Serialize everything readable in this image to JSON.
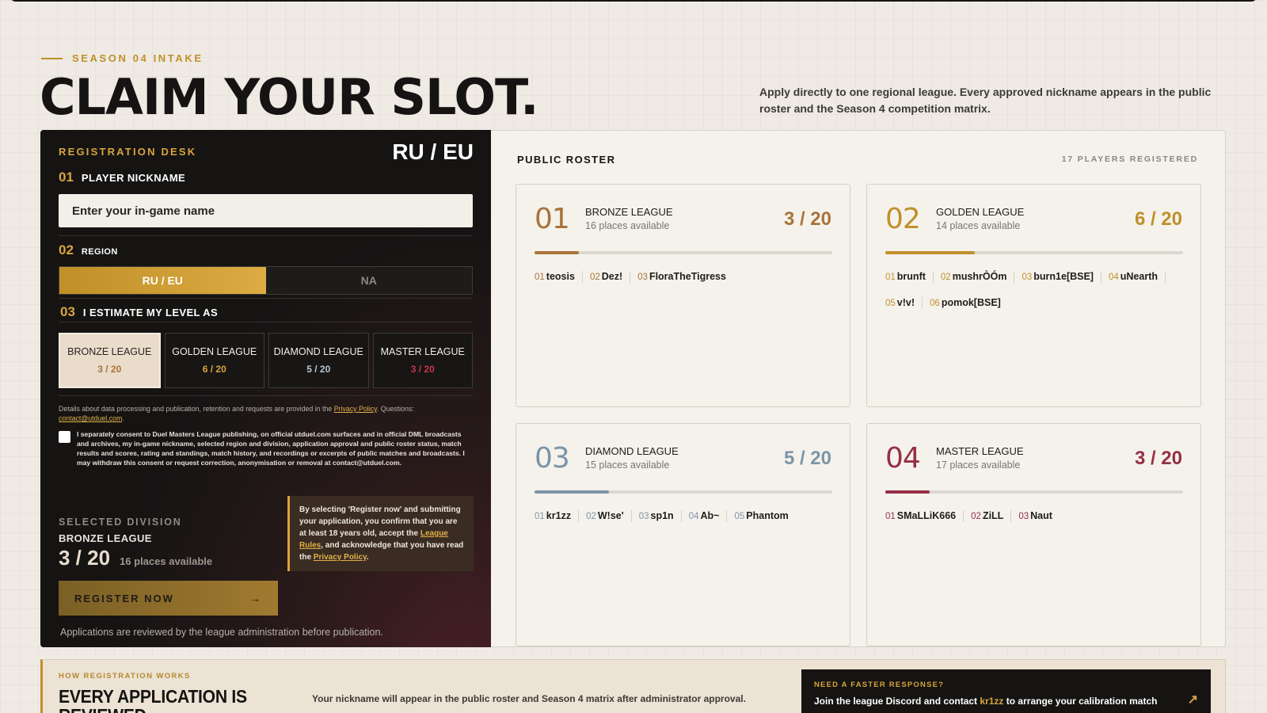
{
  "hero": {
    "eyebrow": "SEASON 04 INTAKE",
    "title": "CLAIM YOUR SLOT.",
    "intro": "Apply directly to one regional league. Every approved nickname appears in the public roster and the Season 4 competition matrix."
  },
  "registration": {
    "title": "REGISTRATION DESK",
    "region_display": "RU / EU",
    "step1": {
      "num": "01",
      "label": "PLAYER NICKNAME"
    },
    "nickname_placeholder": "Enter your in-game name",
    "step2": {
      "num": "02",
      "label": "REGION"
    },
    "regions": [
      {
        "label": "RU / EU",
        "active": true
      },
      {
        "label": "NA",
        "active": false
      }
    ],
    "step3": {
      "num": "03",
      "label": "I ESTIMATE MY LEVEL AS"
    },
    "levels": [
      {
        "name": "BRONZE LEAGUE",
        "count": "3 / 20",
        "color": "#a8733a",
        "selected": true
      },
      {
        "name": "GOLDEN LEAGUE",
        "count": "6 / 20",
        "color": "#d9a43d",
        "selected": false
      },
      {
        "name": "DIAMOND LEAGUE",
        "count": "5 / 20",
        "color": "#b8c6d2",
        "selected": false
      },
      {
        "name": "MASTER LEAGUE",
        "count": "3 / 20",
        "color": "#c8354c",
        "selected": false
      }
    ],
    "privacy_text": "Details about data processing and publication, retention and requests are provided in the",
    "privacy_link": "Privacy Policy",
    "questions_text": ". Questions:",
    "contact_email": "contact@utduel.com",
    "consent_text": "I separately consent to Duel Masters League publishing, on official utduel.com surfaces and in official DML broadcasts and archives, my in-game nickname, selected region and division, application approval and public roster status, match results and scores, rating and standings, match history, and recordings or excerpts of public matches and broadcasts. I may withdraw this consent or request correction, anonymisation or removal at contact@utduel.com.",
    "selected_label": "SELECTED DIVISION",
    "selected_name": "BRONZE LEAGUE",
    "selected_count": "3 / 20",
    "selected_available": "16 places available",
    "notice_part1": "By selecting 'Register now' and submitting your application, you confirm that you are at least 18 years old, accept the",
    "notice_link1": "League Rules",
    "notice_part2": ", and acknowledge that you have read the",
    "notice_link2": "Privacy Policy",
    "notice_end": ".",
    "register_label": "REGISTER NOW",
    "register_arrow": "→",
    "review_note": "Applications are reviewed by the league administration before publication."
  },
  "roster": {
    "title": "PUBLIC ROSTER",
    "count_label": "17 PLAYERS REGISTERED",
    "leagues": [
      {
        "num": "01",
        "name": "BRONZE LEAGUE",
        "available": "16 places available",
        "count": "3 / 20",
        "fill": 0.15,
        "color": "#a8733a",
        "players": [
          {
            "n": "01",
            "name": "teosis"
          },
          {
            "n": "02",
            "name": "Dez!"
          },
          {
            "n": "03",
            "name": "FloraTheTigress"
          }
        ]
      },
      {
        "num": "02",
        "name": "GOLDEN LEAGUE",
        "available": "14 places available",
        "count": "6 / 20",
        "fill": 0.3,
        "color": "#c0902b",
        "players": [
          {
            "n": "01",
            "name": "brunft"
          },
          {
            "n": "02",
            "name": "mushrÒÓm"
          },
          {
            "n": "03",
            "name": "burn1e[BSE]"
          },
          {
            "n": "04",
            "name": "uNearth"
          },
          {
            "n": "05",
            "name": "v!v!"
          },
          {
            "n": "06",
            "name": "pomok[BSE]"
          }
        ]
      },
      {
        "num": "03",
        "name": "DIAMOND LEAGUE",
        "available": "15 places available",
        "count": "5 / 20",
        "fill": 0.25,
        "color": "#7d94a6",
        "players": [
          {
            "n": "01",
            "name": "kr1zz"
          },
          {
            "n": "02",
            "name": "W!se'"
          },
          {
            "n": "03",
            "name": "sp1n"
          },
          {
            "n": "04",
            "name": "Ab~"
          },
          {
            "n": "05",
            "name": "Phantom"
          }
        ]
      },
      {
        "num": "04",
        "name": "MASTER LEAGUE",
        "available": "17 places available",
        "count": "3 / 20",
        "fill": 0.15,
        "color": "#962f45",
        "players": [
          {
            "n": "01",
            "name": "SMaLLiK666"
          },
          {
            "n": "02",
            "name": "ZiLL"
          },
          {
            "n": "03",
            "name": "Naut"
          }
        ]
      }
    ]
  },
  "how": {
    "kicker": "HOW REGISTRATION WORKS",
    "heading": "EVERY APPLICATION IS REVIEWED",
    "desc": "Your nickname will appear in the public roster and Season 4 matrix after administrator approval."
  },
  "faster": {
    "kicker": "NEED A FASTER RESPONSE?",
    "text_pre": "Join the league Discord and contact",
    "handle": "kr1zz",
    "text_post": "to arrange your calibration match",
    "arrow": "↗"
  }
}
